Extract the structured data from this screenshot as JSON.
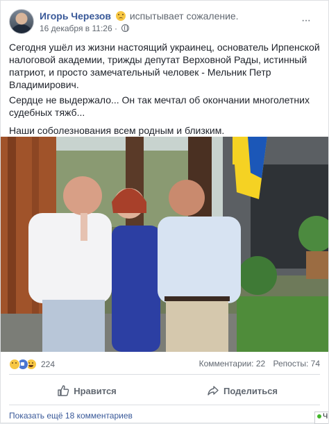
{
  "post": {
    "author": "Игорь Черезов",
    "feeling": "испытывает сожаление.",
    "date": "16 декабря в 11:26 ·",
    "paragraphs": [
      "Сегодня ушёл из жизни настоящий украинец, основатель Ирпенской налоговой академии, трижды депутат Верховной Рады, истинный патриот, и просто замечательный человек - Мельник Петр Владимирович.",
      "Сердце не выдержало... Он так мечтал об окончании многолетних судебных тяжб...",
      "Наши соболезнования всем родным и близким."
    ]
  },
  "reactions": {
    "icons": [
      "sad-reaction-icon",
      "like-reaction-icon",
      "haha-reaction-icon"
    ],
    "count": "224"
  },
  "stats": {
    "comments": "Комментарии: 22",
    "shares": "Репосты: 74"
  },
  "actions": {
    "like": "Нравится",
    "share": "Поделиться"
  },
  "footer": {
    "more_comments": "Показать ещё 18 комментариев",
    "chat_letter": "Ч"
  },
  "colors": {
    "link": "#385898",
    "secondary_text": "#606770",
    "ukraine_blue": "#1b57b8",
    "ukraine_yellow": "#f5d223"
  }
}
